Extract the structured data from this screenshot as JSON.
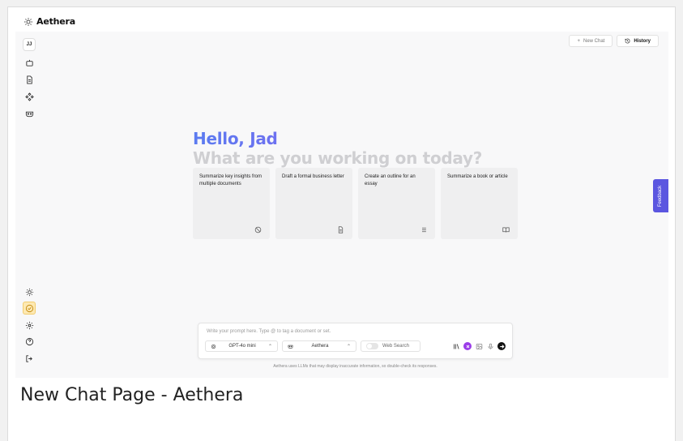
{
  "app": {
    "name": "Aethera",
    "avatar_initials": "JJ"
  },
  "header": {
    "new_chat_label": "New Chat",
    "history_label": "History"
  },
  "greeting": {
    "hello": "Hello, Jad",
    "subtitle": "What are you working on today?"
  },
  "cards": [
    {
      "text": "Summarize key insights from multiple documents",
      "icon": "ban-icon"
    },
    {
      "text": "Draft a formal business letter",
      "icon": "document-icon"
    },
    {
      "text": "Create an outline for an essay",
      "icon": "list-icon"
    },
    {
      "text": "Summarize a book or article",
      "icon": "book-icon"
    }
  ],
  "feedback_label": "Feedback",
  "prompt": {
    "placeholder": "Write your prompt here. Type @ to tag a document or set.",
    "model": "GPT-4o mini",
    "assistant": "Aethera",
    "web_search_label": "Web Search"
  },
  "disclaimer": "Aethera uses LLMs that may display inaccurate information, so double-check its responses.",
  "caption": "New Chat Page - Aethera",
  "colors": {
    "accent": "#5b56e0",
    "active_bg": "#fde9b3",
    "purple": "#9b3de8"
  }
}
